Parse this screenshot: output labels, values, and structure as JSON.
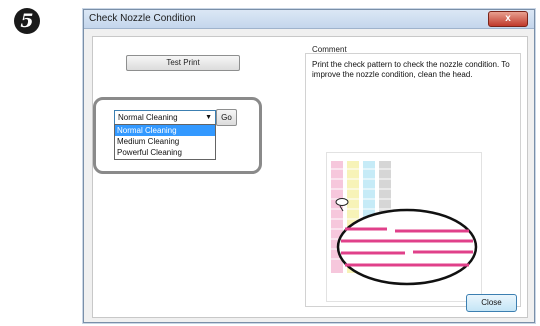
{
  "step": {
    "number": "5"
  },
  "window": {
    "title": "Check Nozzle Condition",
    "close_glyph": "x"
  },
  "buttons": {
    "test_print": "Test Print",
    "go": "Go",
    "close": "Close"
  },
  "cleaning": {
    "selected": "Normal Cleaning",
    "options": [
      "Normal Cleaning",
      "Medium Cleaning",
      "Powerful Cleaning"
    ]
  },
  "comment": {
    "label": "Comment",
    "text": "Print the check pattern to check the nozzle condition. To improve the nozzle condition, clean the head."
  },
  "colors": {
    "magenta": "#e0408a",
    "cyan": "#7fd6f2",
    "yellow": "#f5f08a",
    "black": "#555555",
    "selection_blue": "#3399ff",
    "highlight_gray": "#8a8a8a"
  },
  "icons": {
    "dropdown_arrow": "caret-down-icon",
    "step_badge": "step-number-icon"
  }
}
